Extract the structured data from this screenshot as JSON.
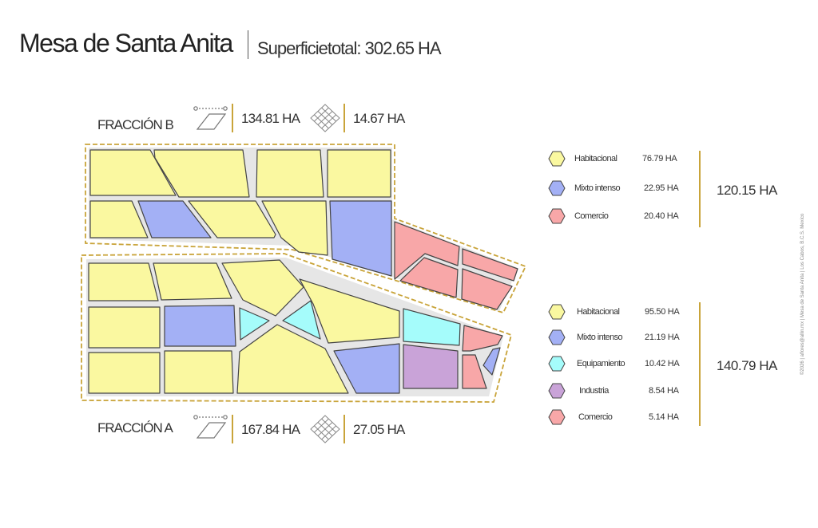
{
  "header": {
    "title": "Mesa de Santa Anita",
    "subtitle": "Superficietotal: 302.65 HA"
  },
  "fraccion_b": {
    "label": "FRACCIÓN B",
    "area": "134.81 HA",
    "lots": "14.67 HA",
    "area_icon": "polygon-area-icon",
    "lots_icon": "lots-grid-icon"
  },
  "fraccion_a": {
    "label": "FRACCIÓN A",
    "area": "167.84 HA",
    "lots": "27.05 HA",
    "area_icon": "polygon-area-icon",
    "lots_icon": "lots-grid-icon"
  },
  "legend_b": {
    "total": "120.15 HA",
    "items": [
      {
        "label": "Habitacional",
        "value": "76.79 HA",
        "color": "#faf8a0"
      },
      {
        "label": "Mixto intenso",
        "value": "22.95 HA",
        "color": "#a3b0f5"
      },
      {
        "label": "Comercio",
        "value": "20.40 HA",
        "color": "#f8a7a8"
      }
    ]
  },
  "legend_a": {
    "total": "140.79 HA",
    "items": [
      {
        "label": "Habitacional",
        "value": "95.50 HA",
        "color": "#faf8a0"
      },
      {
        "label": "Mixto intenso",
        "value": "21.19 HA",
        "color": "#a3b0f5"
      },
      {
        "label": "Equipamiento",
        "value": "10.42 HA",
        "color": "#a5fcfb"
      },
      {
        "label": "Industria",
        "value": "8.54 HA",
        "color": "#c9a3d8"
      },
      {
        "label": "Comercio",
        "value": "5.14 HA",
        "color": "#f8a7a8"
      }
    ]
  },
  "credit": "©2026 | aflores@allin.mx | Mesa de Santa Anita | Los Cabos, B.C.S. Mexico",
  "colors": {
    "habitacional": "#faf8a0",
    "mixto": "#a3b0f5",
    "comercio": "#f8a7a8",
    "equipamiento": "#a5fcfb",
    "industria": "#c9a3d8",
    "boundary": "#c9a43a",
    "road": "#e6e6e6",
    "outline": "#444444"
  }
}
